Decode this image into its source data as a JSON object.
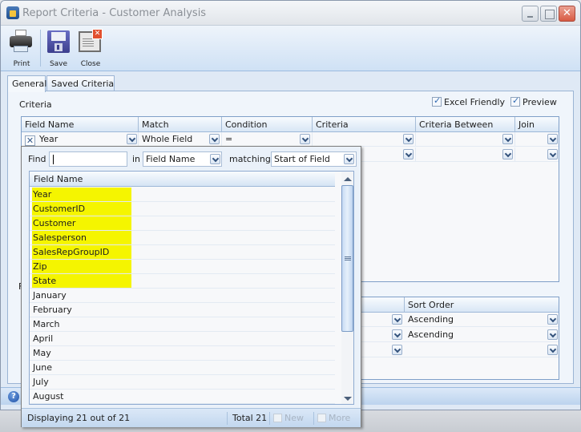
{
  "window": {
    "title": "Report Criteria - Customer Analysis",
    "buttons": {
      "minimize": "minimize",
      "maximize": "maximize",
      "close": "close"
    }
  },
  "toolbar": {
    "print_label": "Print",
    "save_label": "Save",
    "close_label": "Close"
  },
  "tabs": [
    {
      "label": "General",
      "active": true
    },
    {
      "label": "Saved Criteria",
      "active": false
    }
  ],
  "general": {
    "criteria_label": "Criteria",
    "excel_friendly": {
      "label": "Excel Friendly",
      "checked": true
    },
    "preview": {
      "label": "Preview",
      "checked": true
    },
    "criteria_grid": {
      "columns": [
        "Field Name",
        "Match",
        "Condition",
        "Criteria",
        "Criteria Between",
        "Join"
      ],
      "rows": [
        {
          "field_name": "Year",
          "match": "Whole Field",
          "condition": "=",
          "criteria": "",
          "criteria_between": "",
          "join": ""
        },
        {
          "field_name": "",
          "match": "",
          "condition": "",
          "criteria": "",
          "criteria_between": "",
          "join": ""
        }
      ]
    },
    "sort_label_partial": "F",
    "sort_grid": {
      "columns": [
        "Sort Order"
      ],
      "rows": [
        {
          "sort_order": "Ascending"
        },
        {
          "sort_order": "Ascending"
        },
        {
          "sort_order": ""
        }
      ]
    }
  },
  "field_picker": {
    "find_label": "Find",
    "find_value": "",
    "in_label": "in",
    "in_value": "Field Name",
    "matching_label": "matching",
    "matching_value": "Start of Field",
    "list_header": "Field Name",
    "items": [
      {
        "label": "Year",
        "highlighted": true
      },
      {
        "label": "CustomerID",
        "highlighted": true
      },
      {
        "label": "Customer",
        "highlighted": true
      },
      {
        "label": "Salesperson",
        "highlighted": true
      },
      {
        "label": "SalesRepGroupID",
        "highlighted": true
      },
      {
        "label": "Zip",
        "highlighted": true
      },
      {
        "label": "State",
        "highlighted": true
      },
      {
        "label": "January",
        "highlighted": false
      },
      {
        "label": "February",
        "highlighted": false
      },
      {
        "label": "March",
        "highlighted": false
      },
      {
        "label": "April",
        "highlighted": false
      },
      {
        "label": "May",
        "highlighted": false
      },
      {
        "label": "June",
        "highlighted": false
      },
      {
        "label": "July",
        "highlighted": false
      },
      {
        "label": "August",
        "highlighted": false
      }
    ],
    "status": "Displaying 21 out of 21",
    "total": "Total 21",
    "new_label": "New",
    "more_label": "More"
  },
  "colors": {
    "highlight": "#f5f500",
    "accent": "#7f9fc8"
  }
}
